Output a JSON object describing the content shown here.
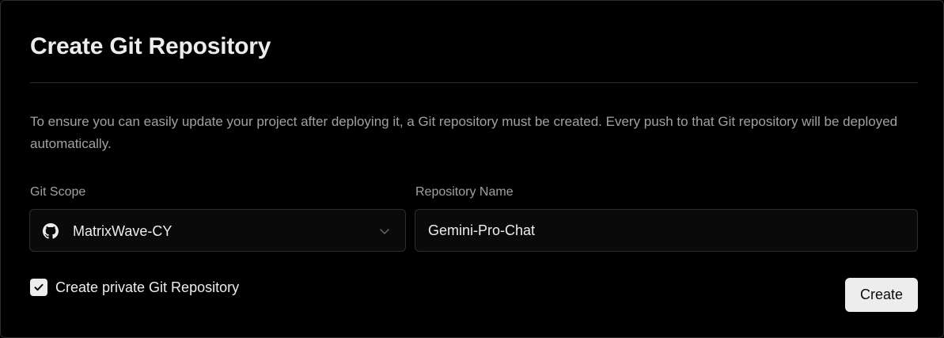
{
  "dialog": {
    "title": "Create Git Repository",
    "description": "To ensure you can easily update your project after deploying it, a Git repository must be created. Every push to that Git repository will be deployed automatically."
  },
  "git_scope": {
    "label": "Git Scope",
    "selected": "MatrixWave-CY",
    "icon": "github-icon"
  },
  "repository_name": {
    "label": "Repository Name",
    "value": "Gemini-Pro-Chat"
  },
  "private_repo": {
    "label": "Create private Git Repository",
    "checked": true
  },
  "actions": {
    "create_label": "Create"
  },
  "colors": {
    "background": "#000000",
    "border": "#2e2e2e",
    "text_primary": "#ededed",
    "text_secondary": "#a1a1a1",
    "button_bg": "#ededed"
  }
}
